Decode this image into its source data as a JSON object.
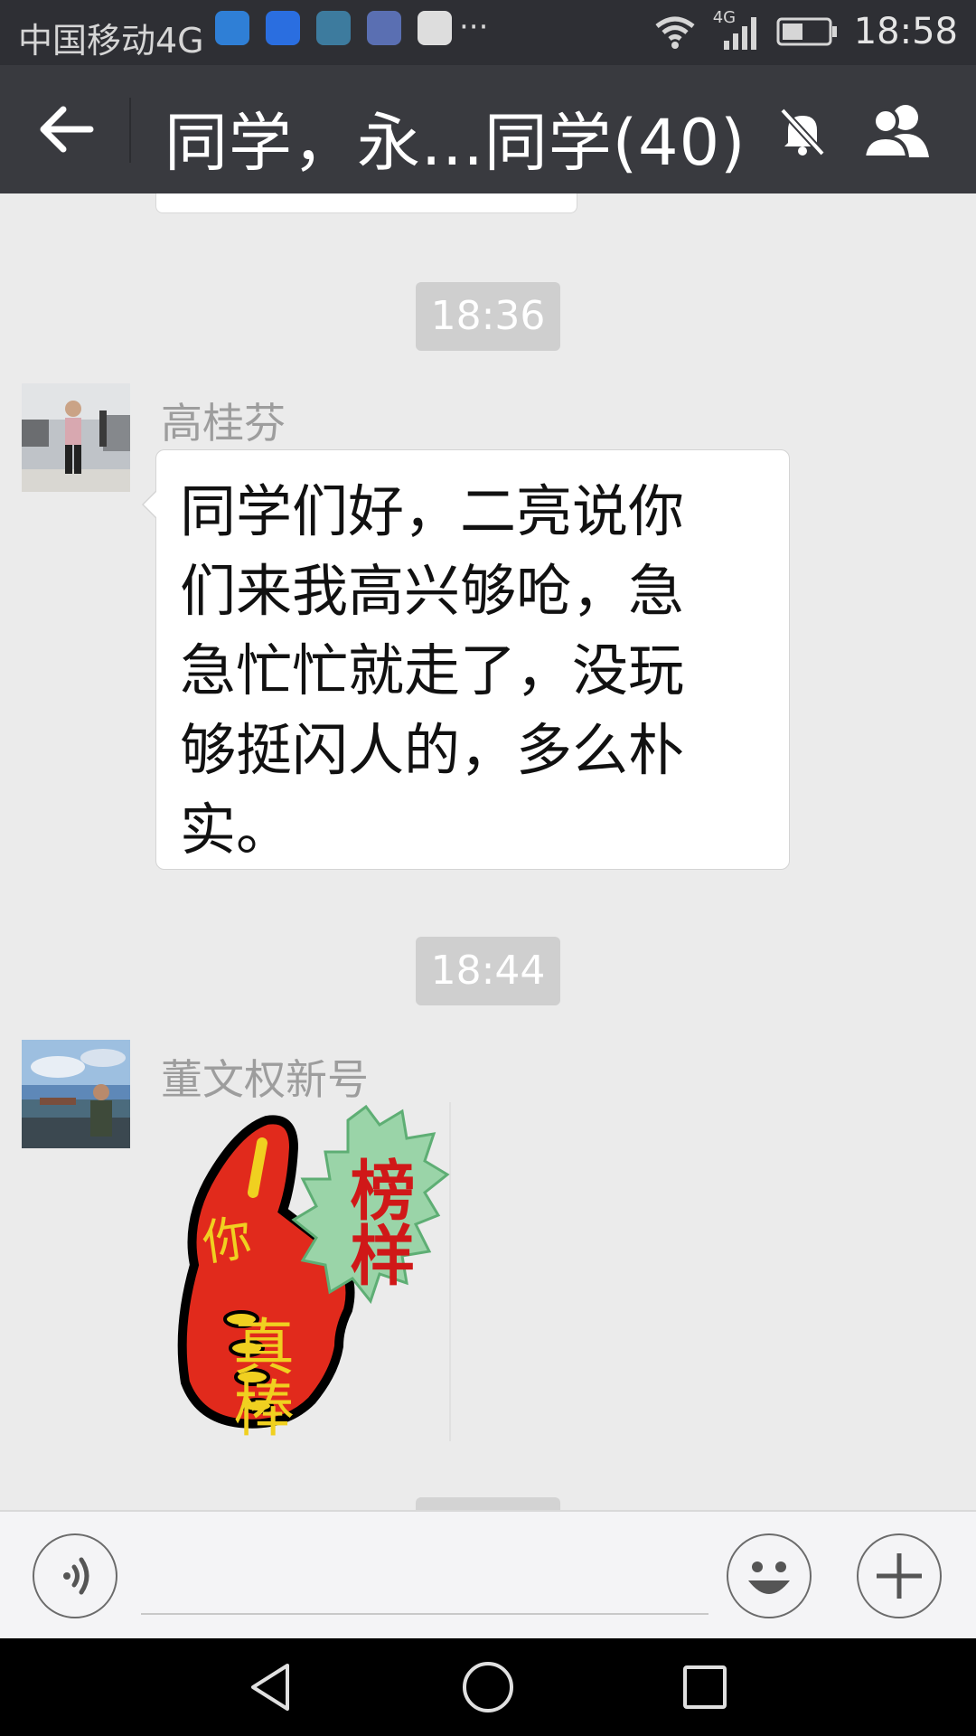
{
  "status_bar": {
    "carrier": "中国移动4G",
    "more_indicator": "···",
    "network_label": "4G",
    "time": "18:58"
  },
  "header": {
    "title": "同学，永...同学(40)",
    "back_icon": "arrow-left-icon",
    "mute_icon": "bell-muted-icon",
    "members_icon": "group-icon"
  },
  "messages": [
    {
      "type": "time",
      "text": "18:36"
    },
    {
      "type": "text",
      "sender": "高桂芬",
      "lines": [
        "同学们好，二亮说你",
        "们来我高兴够呛，急",
        "急忙忙就走了，没玩",
        "够挺闪人的，多么朴",
        "实。"
      ]
    },
    {
      "type": "time",
      "text": "18:44"
    },
    {
      "type": "sticker",
      "sender": "董文权新号",
      "sticker_text": {
        "left": "你",
        "bottom": "真棒",
        "badge": "榜样"
      }
    }
  ],
  "input_bar": {
    "voice_icon": "voice-icon",
    "emoji_icon": "smiley-icon",
    "plus_icon": "plus-icon",
    "input_value": ""
  },
  "nav_bar": {
    "back_icon": "triangle-back-icon",
    "home_icon": "circle-home-icon",
    "recents_icon": "square-recents-icon"
  },
  "colors": {
    "title_bar": "#393a3f",
    "status_bar": "#2e2f34",
    "chat_bg": "#ebebeb",
    "time_pill": "#cfcfcf"
  }
}
